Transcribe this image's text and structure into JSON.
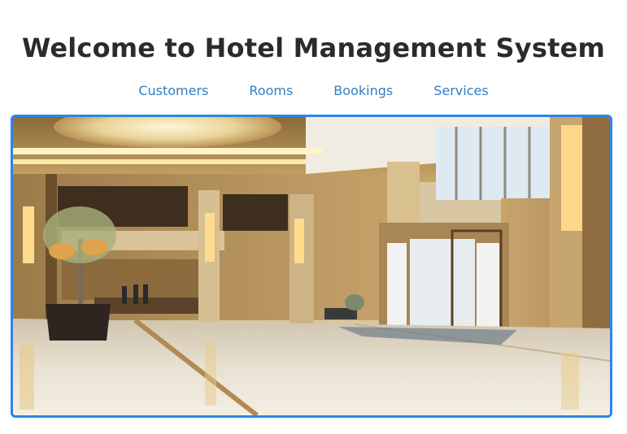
{
  "header": {
    "title": "Welcome to Hotel Management System"
  },
  "nav": {
    "items": [
      {
        "label": "Customers"
      },
      {
        "label": "Rooms"
      },
      {
        "label": "Bookings"
      },
      {
        "label": "Services"
      }
    ]
  },
  "hero": {
    "image_subject": "hotel-lobby",
    "accent_border_color": "#2b86e6",
    "link_color": "#2f7fc4"
  }
}
